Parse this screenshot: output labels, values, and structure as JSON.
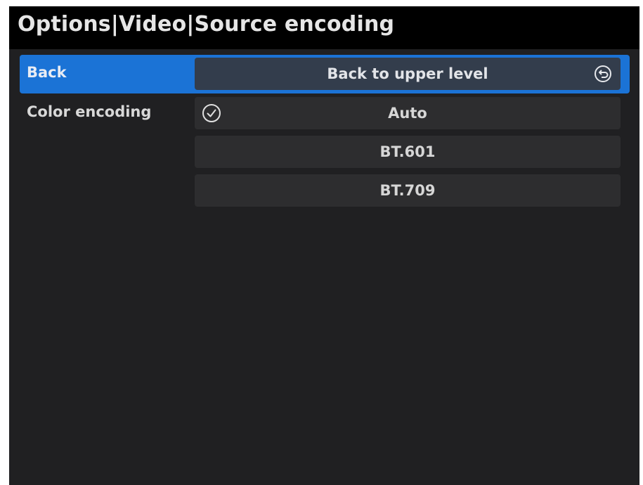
{
  "header": {
    "title": "Options|Video|Source encoding"
  },
  "menu": {
    "back": {
      "label": "Back",
      "value": "Back to upper level",
      "icon": "back-arrow-circle-icon",
      "highlight_color": "#1b73d6"
    },
    "color_encoding": {
      "label": "Color encoding",
      "selected": "Auto",
      "options": [
        {
          "label": "Auto",
          "selected": true,
          "icon": "check-circle-icon"
        },
        {
          "label": "BT.601",
          "selected": false
        },
        {
          "label": "BT.709",
          "selected": false
        }
      ]
    }
  }
}
